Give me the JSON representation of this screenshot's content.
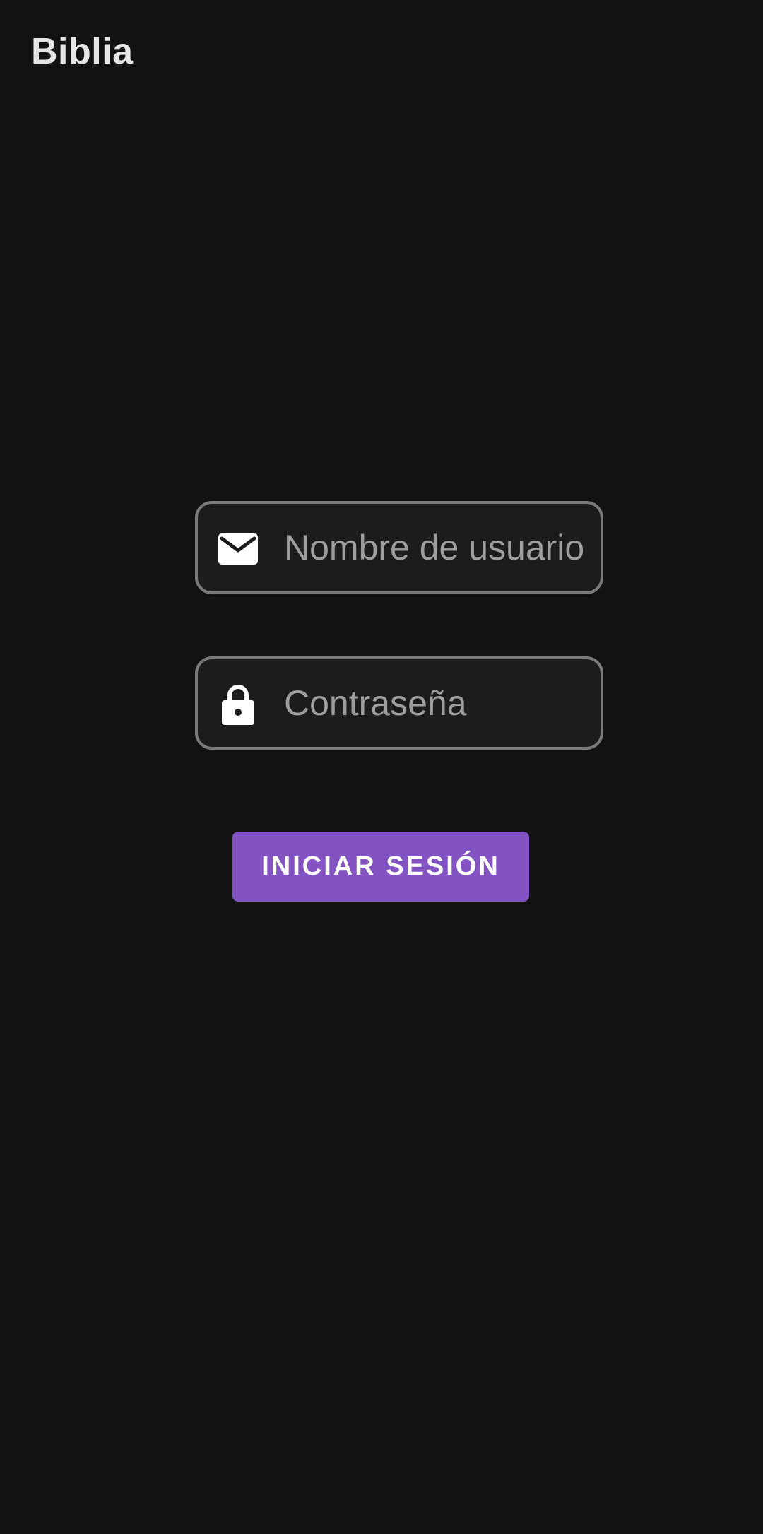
{
  "app_bar": {
    "title": "Biblia"
  },
  "login_form": {
    "username": {
      "icon": "email-icon",
      "placeholder": "Nombre de usuario",
      "value": ""
    },
    "password": {
      "icon": "lock-icon",
      "placeholder": "Contraseña",
      "value": ""
    },
    "submit_label": "INICIAR SESIÓN"
  },
  "colors": {
    "background": "#121212",
    "field_background": "#1c1c1c",
    "field_border": "#7a7a7a",
    "placeholder": "#9e9e9e",
    "button": "#8353c3",
    "button_text": "#ffffff",
    "icon": "#ffffff"
  }
}
